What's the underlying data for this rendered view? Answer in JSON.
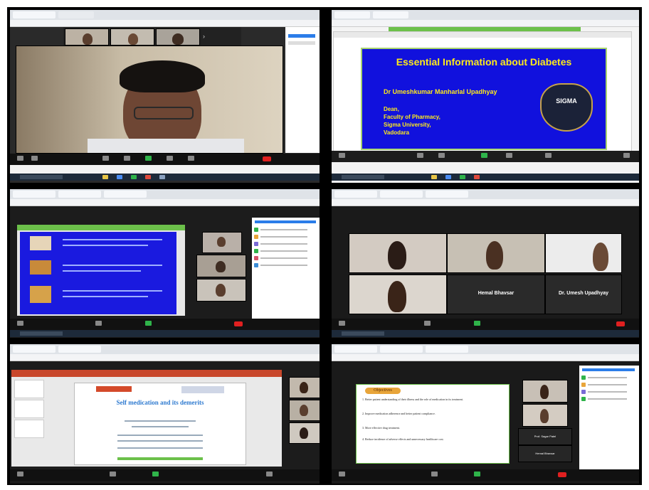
{
  "panels": {
    "top_right": {
      "slide_title": "Essential Information about Diabetes",
      "presenter": "Dr Umeshkumar Manharlal Upadhyay",
      "role_lines": [
        "Dean,",
        "Faculty of Pharmacy,",
        "Sigma University,",
        "Vadodara"
      ],
      "seal_text": "SIGMA"
    },
    "mid_right": {
      "tile_names": [
        "Hemal Bhavsar",
        "Dr. Umesh Upadhyay"
      ]
    },
    "bottom_left": {
      "slide_title": "Self medication and its demerits"
    },
    "bottom_right": {
      "heading": "Objectives",
      "objectives": [
        "1.  Better patient understanding of their illness and the role of medication in its treatment.",
        "2.  Improve medication adherence and better patient compliance.",
        "3.  More effective drug treatment.",
        "4.  Reduce incidence of adverse effects and unnecessary healthcare cost."
      ],
      "tile_names": [
        "Prof. Sagar Patel",
        "Hemal Bhavsar"
      ]
    }
  },
  "colors": {
    "slide_blue": "#1111dd",
    "slide_yellow": "#ffeb1a",
    "zoom_end_red": "#e02020",
    "ppt_orange": "#c8472b",
    "green_border": "#a7d36f"
  }
}
